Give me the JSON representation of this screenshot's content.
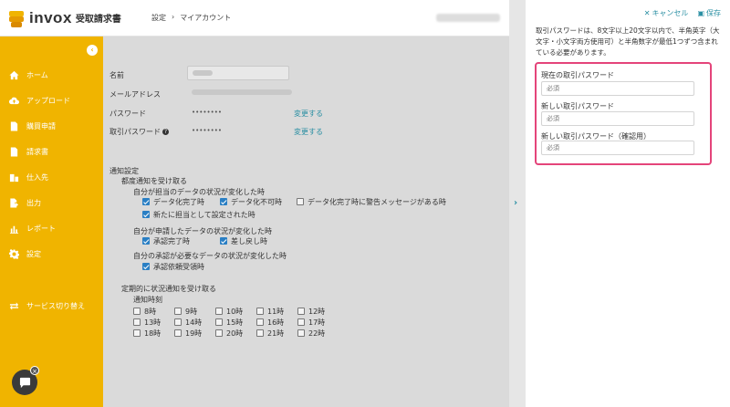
{
  "header": {
    "logo_text": "invox",
    "logo_sub": "受取請求書",
    "breadcrumb": [
      "設定",
      "マイアカウント"
    ]
  },
  "sidebar": {
    "collapse_icon": "‹",
    "items": [
      {
        "label": "ホーム",
        "icon": "home-icon"
      },
      {
        "label": "アップロード",
        "icon": "upload-icon"
      },
      {
        "label": "購買申請",
        "icon": "document-icon"
      },
      {
        "label": "請求書",
        "icon": "invoice-icon"
      },
      {
        "label": "仕入先",
        "icon": "building-icon"
      },
      {
        "label": "出力",
        "icon": "export-icon"
      },
      {
        "label": "レポート",
        "icon": "chart-icon"
      },
      {
        "label": "設定",
        "icon": "gear-icon"
      },
      {
        "label": "サービス切り替え",
        "icon": "switch-icon"
      }
    ],
    "chat_close": "×"
  },
  "account": {
    "name_label": "名前",
    "email_label": "メールアドレス",
    "password_label": "パスワード",
    "password_value": "••••••••",
    "tx_password_label": "取引パスワード",
    "tx_password_value": "••••••••",
    "change_link": "変更する"
  },
  "notifications": {
    "title": "通知設定",
    "each": "都度通知を受け取る",
    "group1": "自分が担当のデータの状況が変化した時",
    "g1_items": [
      "データ化完了時",
      "データ化不可時",
      "データ化完了時に警告メッセージがある時",
      "新たに担当として設定された時"
    ],
    "group2": "自分が申請したデータの状況が変化した時",
    "g2_items": [
      "承認完了時",
      "差し戻し時"
    ],
    "group3": "自分の承認が必要なデータの状況が変化した時",
    "g3_items": [
      "承認依頼受領時"
    ],
    "periodic": "定期的に状況通知を受け取る",
    "time_label": "通知時刻",
    "hours": [
      "8時",
      "9時",
      "10時",
      "11時",
      "12時",
      "13時",
      "14時",
      "15時",
      "16時",
      "17時",
      "18時",
      "19時",
      "20時",
      "21時",
      "22時"
    ]
  },
  "panel": {
    "cancel": "キャンセル",
    "save": "保存",
    "description": "取引パスワードは、8文字以上20文字以内で、半角英字（大文字・小文字両方使用可）と半角数字が最低1つずつ含まれている必要があります。",
    "current_label": "現在の取引パスワード",
    "new_label": "新しい取引パスワード",
    "confirm_label": "新しい取引パスワード（確認用）",
    "placeholder": "必須"
  },
  "colors": {
    "sidebar": "#f0b400",
    "accent": "#2a8fa3",
    "highlight": "#e4447a",
    "checkbox": "#2a7fc4"
  }
}
